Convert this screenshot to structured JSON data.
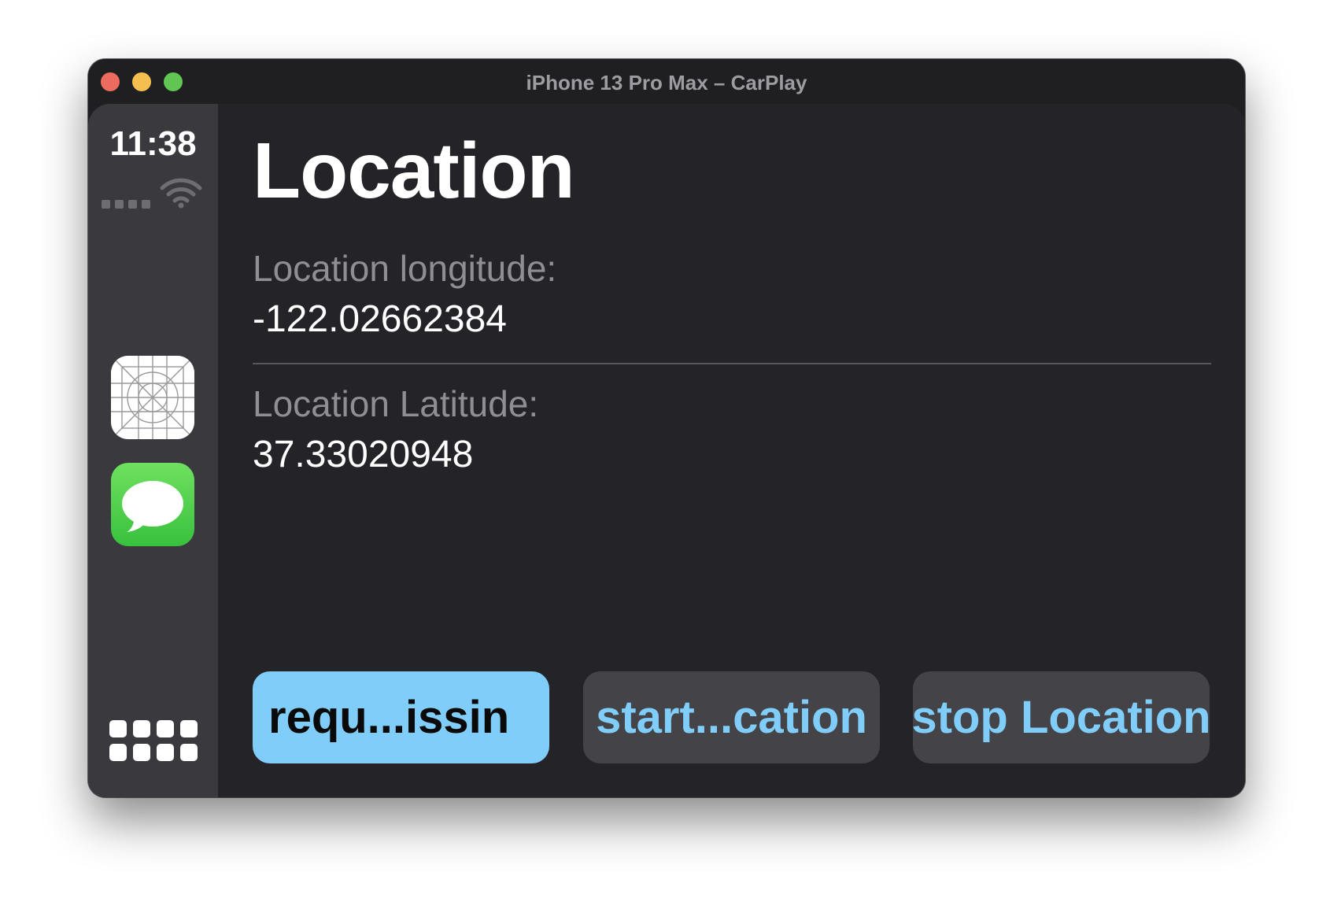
{
  "window": {
    "title": "iPhone 13 Pro Max – CarPlay"
  },
  "status": {
    "time": "11:38"
  },
  "sidebar": {
    "apps": [
      {
        "name": "generic-app",
        "icon": "app-placeholder-icon"
      },
      {
        "name": "messages",
        "icon": "messages-icon"
      }
    ],
    "home_icon": "app-grid-icon"
  },
  "main": {
    "title": "Location",
    "fields": [
      {
        "label": "Location longitude:",
        "value": "-122.02662384"
      },
      {
        "label": "Location Latitude:",
        "value": "37.33020948"
      }
    ],
    "buttons": [
      {
        "label": "requ...issin"
      },
      {
        "label": "start...cation"
      },
      {
        "label": "stop Location"
      }
    ]
  },
  "colors": {
    "accent": "#7fcdf8",
    "background": "#242428",
    "sidebar": "#3a3a3e",
    "button_secondary": "#444448",
    "label_secondary": "#8e8e93"
  }
}
